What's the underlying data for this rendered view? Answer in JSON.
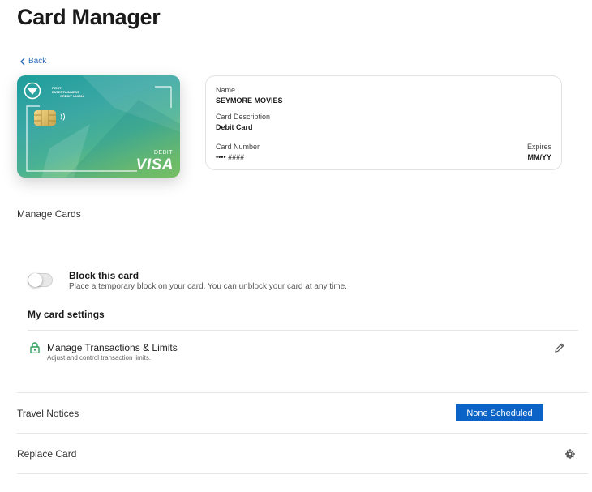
{
  "page": {
    "title": "Card Manager",
    "back_label": "Back"
  },
  "card": {
    "issuer_lines": [
      "FIRST",
      "ENTERTAINMENT",
      "CREDIT UNION"
    ],
    "type_label": "DEBIT",
    "brand": "VISA"
  },
  "details": {
    "name_label": "Name",
    "name_value": "SEYMORE MOVIES",
    "description_label": "Card Description",
    "description_value": "Debit Card",
    "number_label": "Card Number",
    "number_value": "•••• ####",
    "expires_label": "Expires",
    "expires_value": "MM/YY"
  },
  "manage": {
    "heading": "Manage Cards",
    "block_title": "Block this card",
    "block_description": "Place a temporary block on your card. You can unblock your card at any time.",
    "block_enabled": false,
    "settings_heading": "My card settings",
    "transactions_title": "Manage Transactions & Limits",
    "transactions_description": "Adjust and control transaction limits."
  },
  "travel": {
    "label": "Travel Notices",
    "button_label": "None Scheduled"
  },
  "replace": {
    "label": "Replace Card"
  },
  "colors": {
    "accent": "#0b63c8",
    "link": "#2a6bb5",
    "lock": "#2e9e5b"
  }
}
